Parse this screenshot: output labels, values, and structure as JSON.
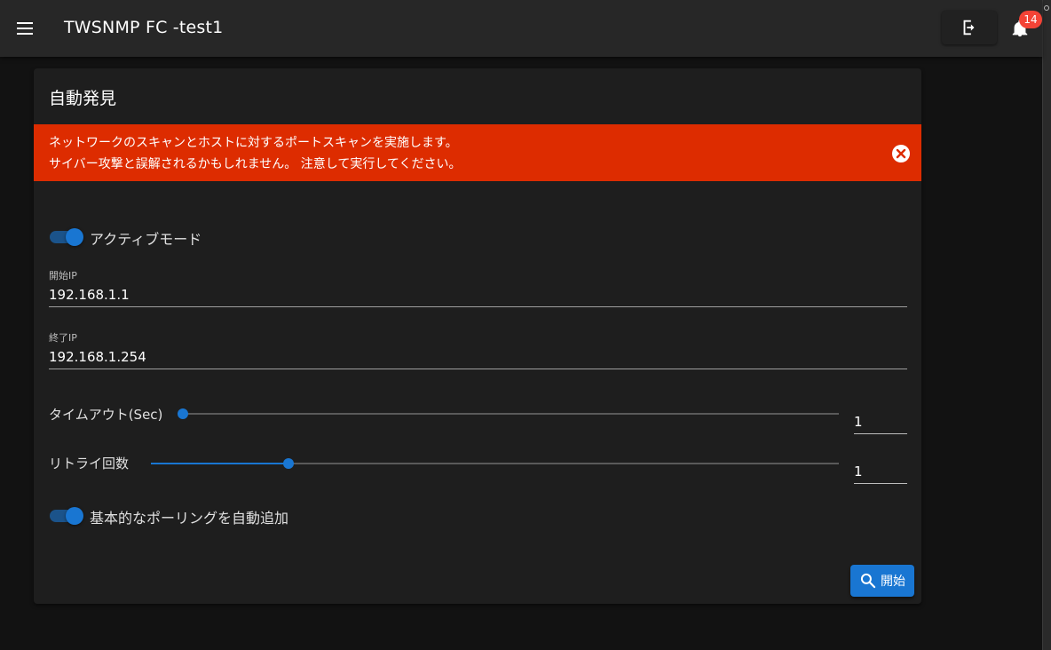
{
  "appbar": {
    "title": "TWSNMP FC -test1",
    "notification_count": "14",
    "icons": [
      "menu-icon",
      "logout-icon",
      "bell-icon"
    ]
  },
  "card": {
    "title": "自動発見",
    "alert": {
      "line1": "ネットワークのスキャンとホストに対するポートスキャンを実施します。",
      "line2": "サイバー攻撃と誤解されるかもしれません。 注意して実行してください。",
      "color": "#dd2c00"
    },
    "active_mode": {
      "label": "アクティブモード",
      "on": true
    },
    "start_ip": {
      "label": "開始IP",
      "value": "192.168.1.1"
    },
    "end_ip": {
      "label": "終了IP",
      "value": "192.168.1.254"
    },
    "timeout": {
      "label": "タイムアウト(Sec)",
      "value": "1",
      "fraction": 0
    },
    "retry": {
      "label": "リトライ回数",
      "value": "1",
      "fraction": 0.2
    },
    "auto_polling": {
      "label": "基本的なポーリングを自動追加",
      "on": true
    },
    "start_button": {
      "label": "開始"
    }
  },
  "colors": {
    "accent": "#1976d2",
    "appbar": "#272727",
    "card": "#1e1e1e",
    "badge": "#f44336"
  }
}
